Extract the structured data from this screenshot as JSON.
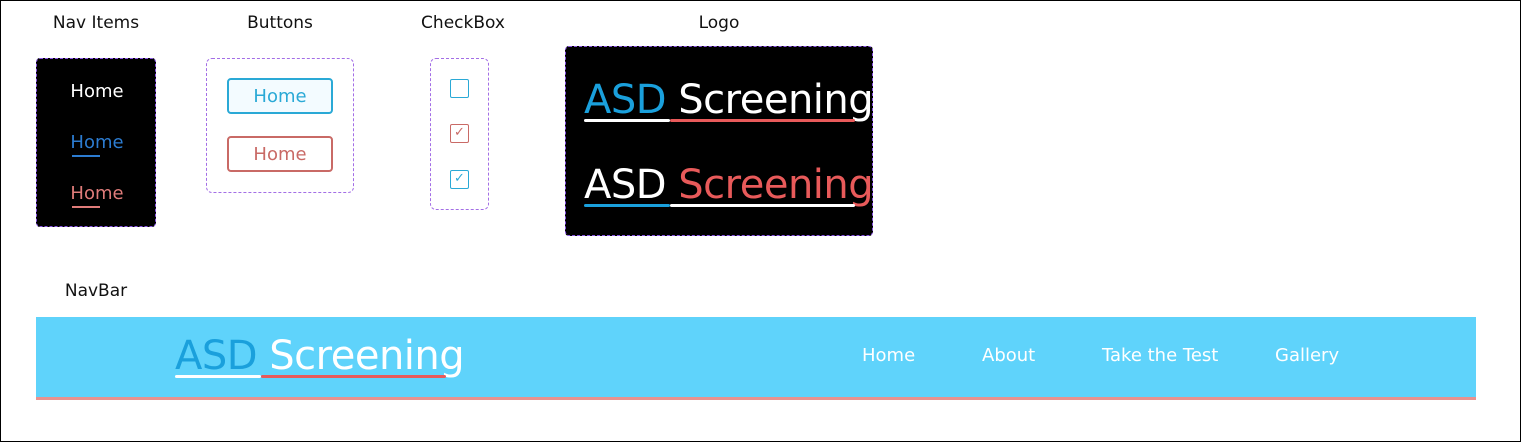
{
  "labels": {
    "nav_items": "Nav Items",
    "buttons": "Buttons",
    "checkbox": "CheckBox",
    "logo": "Logo",
    "navbar": "NavBar"
  },
  "nav_items": [
    {
      "label": "Home",
      "state": "default",
      "color": "#ffffff"
    },
    {
      "label": "Home",
      "state": "active",
      "color": "#2c7cd1"
    },
    {
      "label": "Home",
      "state": "hover",
      "color": "#e07c7a"
    }
  ],
  "buttons": {
    "primary_label": "Home",
    "secondary_label": "Home"
  },
  "checkboxes": [
    {
      "checked": false,
      "color": "#2aa9d6"
    },
    {
      "checked": true,
      "color": "#c96a66"
    },
    {
      "checked": true,
      "color": "#2aa9d6"
    }
  ],
  "logo": {
    "word1": "ASD",
    "word2": "Screening"
  },
  "navbar": {
    "brand_word1": "ASD",
    "brand_word2": "Screening",
    "links": [
      "Home",
      "About",
      "Take the Test",
      "Gallery"
    ]
  },
  "colors": {
    "accent_blue": "#1aa0dc",
    "accent_red": "#e85a5a",
    "navbar_bg": "#5fd3fb"
  }
}
